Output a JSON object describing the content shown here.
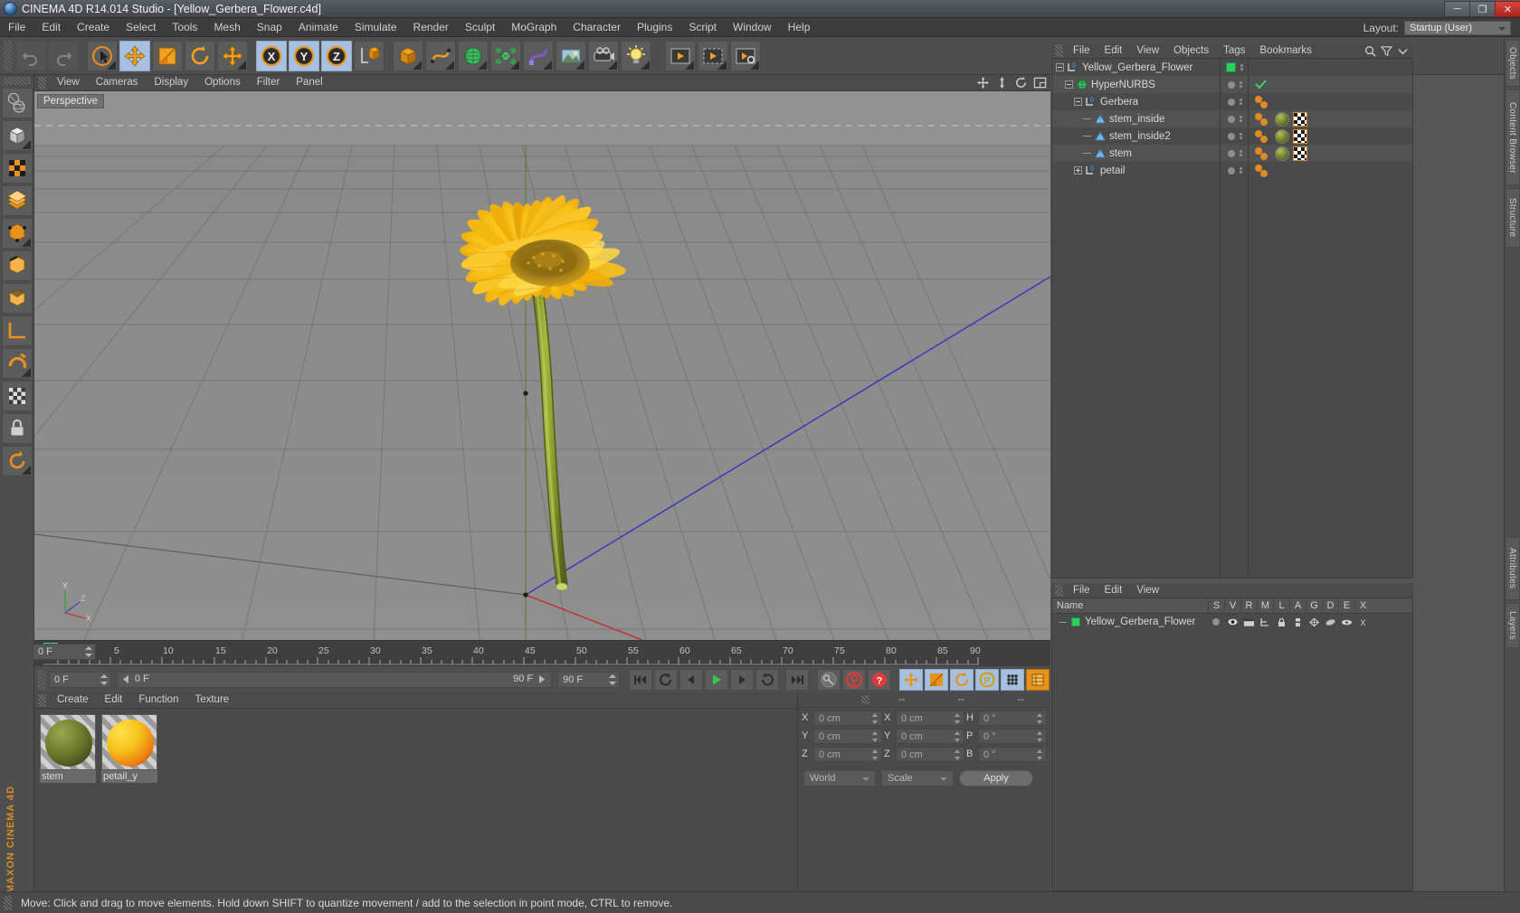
{
  "window": {
    "title": "CINEMA 4D R14.014 Studio - [Yellow_Gerbera_Flower.c4d]",
    "minimize": "─",
    "maximize": "❐",
    "close": "✕"
  },
  "menubar": {
    "items": [
      "File",
      "Edit",
      "Create",
      "Select",
      "Tools",
      "Mesh",
      "Snap",
      "Animate",
      "Simulate",
      "Render",
      "Sculpt",
      "MoGraph",
      "Character",
      "Plugins",
      "Script",
      "Window",
      "Help"
    ],
    "layout_label": "Layout:",
    "layout_value": "Startup (User)"
  },
  "toolbar": {
    "buttons": [
      {
        "name": "undo",
        "icon": "undo-icon",
        "state": "disabled"
      },
      {
        "name": "redo",
        "icon": "redo-icon",
        "state": "disabled"
      },
      {
        "name": "live-selection",
        "icon": "cursor-circle-icon",
        "state": "normal"
      },
      {
        "name": "move",
        "icon": "move-arrows-icon",
        "state": "selected"
      },
      {
        "name": "scale",
        "icon": "scale-box-icon",
        "state": "normal"
      },
      {
        "name": "rotate",
        "icon": "rotate-circle-icon",
        "state": "normal"
      },
      {
        "name": "move-alt",
        "icon": "move-arrows-icon",
        "state": "normal"
      },
      {
        "name": "x-axis",
        "icon": "axis-x-icon",
        "state": "selected",
        "label": "X"
      },
      {
        "name": "y-axis",
        "icon": "axis-y-icon",
        "state": "selected",
        "label": "Y"
      },
      {
        "name": "z-axis",
        "icon": "axis-z-icon",
        "state": "selected",
        "label": "Z"
      },
      {
        "name": "world-object-coord",
        "icon": "world-axis-icon",
        "state": "normal"
      },
      {
        "name": "primitive-cube",
        "icon": "cube-icon",
        "state": "normal"
      },
      {
        "name": "spline-pen",
        "icon": "spline-icon",
        "state": "normal"
      },
      {
        "name": "nurbs-generator",
        "icon": "hypernurbs-icon",
        "state": "normal"
      },
      {
        "name": "array-modeling",
        "icon": "array-icon",
        "state": "normal"
      },
      {
        "name": "deformer",
        "icon": "deformer-icon",
        "state": "normal"
      },
      {
        "name": "environment",
        "icon": "environment-icon",
        "state": "normal"
      },
      {
        "name": "camera",
        "icon": "camera-icon",
        "state": "normal"
      },
      {
        "name": "light",
        "icon": "light-bulb-icon",
        "state": "normal"
      },
      {
        "name": "render-view",
        "icon": "render-view-icon",
        "state": "normal"
      },
      {
        "name": "render-region",
        "icon": "render-region-icon",
        "state": "normal"
      },
      {
        "name": "render-settings",
        "icon": "render-settings-icon",
        "state": "normal"
      }
    ]
  },
  "left_toolbar": {
    "buttons": [
      {
        "name": "viewport-mode",
        "icon": "globe-axis-icon"
      },
      {
        "name": "make-editable",
        "icon": "cube-editable-icon"
      },
      {
        "name": "texture-axis",
        "icon": "checker-icon"
      },
      {
        "name": "polygon-mode",
        "icon": "polygon-mesh-icon"
      },
      {
        "name": "point-mode",
        "icon": "point-mode-icon"
      },
      {
        "name": "edge-mode",
        "icon": "edge-mode-icon"
      },
      {
        "name": "polygon-face-mode",
        "icon": "face-mode-icon"
      },
      {
        "name": "workplane",
        "icon": "workplane-icon"
      },
      {
        "name": "enable-snap",
        "icon": "magnet-icon"
      },
      {
        "name": "quantize",
        "icon": "quantize-icon"
      },
      {
        "name": "lock-axis",
        "icon": "lock-icon"
      },
      {
        "name": "axis-modify",
        "icon": "axis-modify-icon"
      }
    ],
    "brand": "MAXON CINEMA 4D"
  },
  "viewport": {
    "menu": [
      "View",
      "Cameras",
      "Display",
      "Options",
      "Filter",
      "Panel"
    ],
    "label": "Perspective",
    "axis_gizmo": {
      "y": "Y",
      "z": "Z",
      "x": "X"
    },
    "scene_description": "Yellow gerbera flower 3D model on perspective grid floor"
  },
  "timeline": {
    "ticks": [
      0,
      5,
      10,
      15,
      20,
      25,
      30,
      35,
      40,
      45,
      50,
      55,
      60,
      65,
      70,
      75,
      80,
      85,
      90
    ],
    "end_frame_field": "0 F",
    "current_frame": "0 F",
    "frame_left": "0 F",
    "preview_end": "90 F",
    "doc_end": "90 F",
    "playhead_frame": 0,
    "transport": [
      {
        "name": "go-to-start",
        "icon": "skip-start-icon"
      },
      {
        "name": "play-backwards-loop",
        "icon": "loop-icon"
      },
      {
        "name": "step-back",
        "icon": "step-back-icon"
      },
      {
        "name": "play",
        "icon": "play-icon"
      },
      {
        "name": "step-forward",
        "icon": "step-forward-icon"
      },
      {
        "name": "loop-playback",
        "icon": "loop-arrow-icon"
      },
      {
        "name": "go-to-end",
        "icon": "skip-end-icon"
      },
      {
        "name": "record-active-objects",
        "icon": "key-icon"
      },
      {
        "name": "autokeying",
        "icon": "autokey-icon"
      },
      {
        "name": "keyframe-selection",
        "icon": "question-icon"
      },
      {
        "name": "position-key",
        "icon": "move-key-icon"
      },
      {
        "name": "scale-key",
        "icon": "scale-key-icon"
      },
      {
        "name": "rotation-key",
        "icon": "rotate-key-icon"
      },
      {
        "name": "param-key",
        "icon": "param-key-icon"
      },
      {
        "name": "point-level-animation",
        "icon": "pla-icon"
      },
      {
        "name": "timeline-toggle",
        "icon": "timeline-icon"
      }
    ]
  },
  "material_manager": {
    "menu": [
      "Create",
      "Edit",
      "Function",
      "Texture"
    ],
    "materials": [
      {
        "name": "stem",
        "color": "#6e7a2e"
      },
      {
        "name": "petail_y",
        "color": "#f2c417"
      }
    ]
  },
  "coordinate_manager": {
    "headers": [
      "--",
      "--",
      "--"
    ],
    "rows": [
      {
        "axis": "X",
        "position": "0 cm",
        "size_label": "X",
        "size": "0 cm",
        "rot_label": "H",
        "rotation": "0 °"
      },
      {
        "axis": "Y",
        "position": "0 cm",
        "size_label": "Y",
        "size": "0 cm",
        "rot_label": "P",
        "rotation": "0 °"
      },
      {
        "axis": "Z",
        "position": "0 cm",
        "size_label": "Z",
        "size": "0 cm",
        "rot_label": "B",
        "rotation": "0 °"
      }
    ],
    "coord_system": "World",
    "size_mode": "Scale",
    "apply": "Apply"
  },
  "object_manager": {
    "menu": [
      "File",
      "Edit",
      "View",
      "Objects",
      "Tags",
      "Bookmarks"
    ],
    "objects": [
      {
        "name": "Yellow_Gerbera_Flower",
        "depth": 0,
        "icon": "null-object-icon",
        "expander": "minus",
        "visdot": "green-square",
        "check": false,
        "tags": []
      },
      {
        "name": "HyperNURBS",
        "depth": 1,
        "icon": "hypernurbs-icon",
        "expander": "minus",
        "visdot": "gray",
        "check": true,
        "tags": []
      },
      {
        "name": "Gerbera",
        "depth": 2,
        "icon": "null-object-icon",
        "expander": "minus",
        "visdot": "gray",
        "check": false,
        "tags": [
          "dot",
          "dot"
        ]
      },
      {
        "name": "stem_inside",
        "depth": 3,
        "icon": "polygon-object-icon",
        "expander": "none",
        "visdot": "gray",
        "check": false,
        "tags": [
          "dot",
          "dot",
          "material",
          "uvw"
        ]
      },
      {
        "name": "stem_inside2",
        "depth": 3,
        "icon": "polygon-object-icon",
        "expander": "none",
        "visdot": "gray",
        "check": false,
        "tags": [
          "dot",
          "dot",
          "material",
          "uvw"
        ]
      },
      {
        "name": "stem",
        "depth": 3,
        "icon": "polygon-object-icon",
        "expander": "none",
        "visdot": "gray",
        "check": false,
        "tags": [
          "dot",
          "dot",
          "material",
          "uvw"
        ]
      },
      {
        "name": "petail",
        "depth": 2,
        "icon": "null-object-icon",
        "expander": "plus",
        "visdot": "gray",
        "check": false,
        "tags": [
          "dot",
          "dot"
        ]
      }
    ]
  },
  "layer_manager": {
    "menu": [
      "File",
      "Edit",
      "View"
    ],
    "columns": [
      "Name",
      "S",
      "V",
      "R",
      "M",
      "L",
      "A",
      "G",
      "D",
      "E",
      "X"
    ],
    "rows": [
      {
        "name": "Yellow_Gerbera_Flower",
        "color": "#2fcd5e"
      }
    ]
  },
  "right_dock": {
    "tabs": [
      "Objects",
      "Content Browser",
      "Structure",
      "Attributes",
      "Layers"
    ]
  },
  "statusbar": {
    "message": "Move: Click and drag to move elements. Hold down SHIFT to quantize movement / add to the selection in point mode, CTRL to remove."
  },
  "colors": {
    "accent_orange": "#e8921e",
    "selection_blue": "#a8c0e0",
    "green_layer": "#2fcd5e",
    "panel_bg": "#4a4a4a",
    "viewport_bg": "#8b8b8b"
  }
}
